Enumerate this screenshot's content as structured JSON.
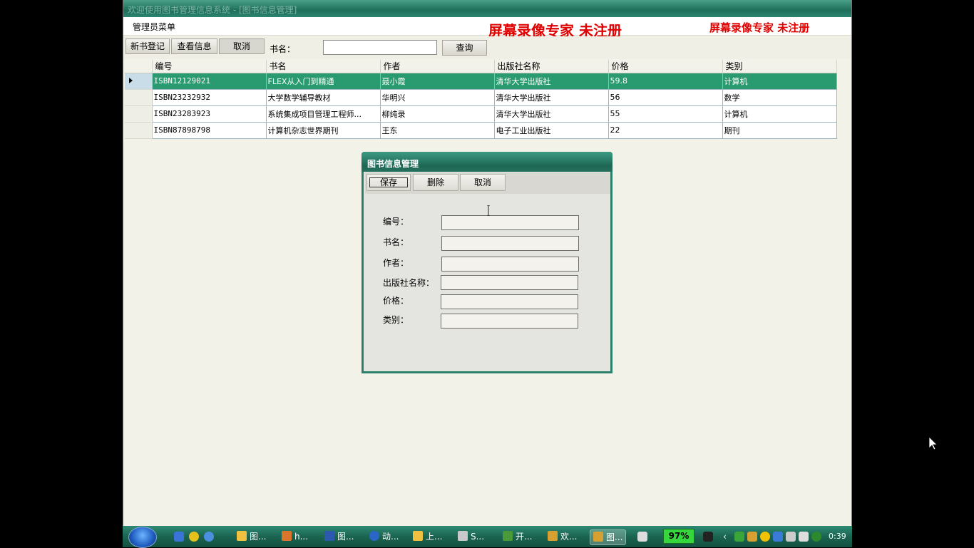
{
  "window": {
    "title": "欢迎使用图书管理信息系统 - [图书信息管理]",
    "menu_admin": "管理员菜单",
    "watermark_large": "屏幕录像专家  未注册",
    "watermark_small": "屏幕录像专家  未注册"
  },
  "toolbar": {
    "new_label": "新书登记",
    "view_label": "查看信息",
    "cancel_label": "取消",
    "bookname_label": "书名：",
    "bookname_value": "",
    "query_label": "查询"
  },
  "grid": {
    "columns": [
      "编号",
      "书名",
      "作者",
      "出版社名称",
      "价格",
      "类别"
    ],
    "rows": [
      {
        "id": "ISBN12129021",
        "name": "FLEX从入门到精通",
        "author": "聂小霞",
        "publisher": "清华大学出版社",
        "price": "59.8",
        "category": "计算机"
      },
      {
        "id": "ISBN23232932",
        "name": "大学数学辅导教材",
        "author": "华明兴",
        "publisher": "清华大学出版社",
        "price": "56",
        "category": "数学"
      },
      {
        "id": "ISBN23283923",
        "name": "系统集成项目管理工程师...",
        "author": "柳纯录",
        "publisher": "清华大学出版社",
        "price": "55",
        "category": "计算机"
      },
      {
        "id": "ISBN87898798",
        "name": "计算机杂志世界期刊",
        "author": "王东",
        "publisher": "电子工业出版社",
        "price": "22",
        "category": "期刊"
      }
    ]
  },
  "dialog": {
    "title": "图书信息管理",
    "save_label": "保存",
    "delete_label": "删除",
    "cancel_label": "取消",
    "fields": {
      "id_label": "编号：",
      "name_label": "书名：",
      "author_label": "作者：",
      "publisher_label": "出版社名称：",
      "price_label": "价格：",
      "category_label": "类别："
    }
  },
  "taskbar": {
    "items": [
      "图...",
      "h...",
      "图...",
      "动...",
      "上...",
      "S...",
      "开...",
      "欢...",
      "图..."
    ],
    "battery": "97%",
    "clock": "0:39"
  },
  "colors": {
    "title_bar": "#1e6e5a",
    "selected_row": "#2a9b70",
    "watermark": "#e00000",
    "battery": "#35d73c"
  }
}
